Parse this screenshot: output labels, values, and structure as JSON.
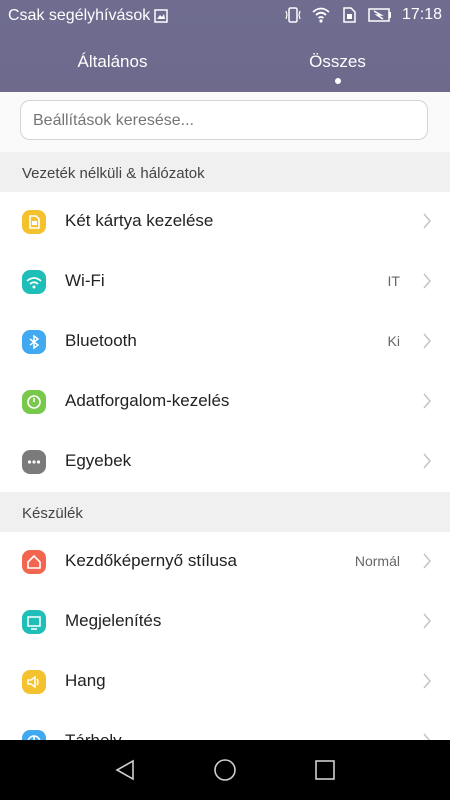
{
  "status_bar": {
    "carrier": "Csak segélyhívások",
    "time": "17:18"
  },
  "tabs": [
    {
      "label": "Általános",
      "active": false
    },
    {
      "label": "Összes",
      "active": true
    }
  ],
  "search": {
    "placeholder": "Beállítások keresése..."
  },
  "sections": [
    {
      "title": "Vezeték nélküli & hálózatok",
      "items": [
        {
          "label": "Két kártya kezelése",
          "value": "",
          "icon": "sim-card-icon",
          "color": "#f5c22f"
        },
        {
          "label": "Wi-Fi",
          "value": "IT",
          "icon": "wifi-icon",
          "color": "#1fbfb8"
        },
        {
          "label": "Bluetooth",
          "value": "Ki",
          "icon": "bluetooth-icon",
          "color": "#40a9f0"
        },
        {
          "label": "Adatforgalom-kezelés",
          "value": "",
          "icon": "data-usage-icon",
          "color": "#78c84b"
        },
        {
          "label": "Egyebek",
          "value": "",
          "icon": "more-icon",
          "color": "#7b7b7b"
        }
      ]
    },
    {
      "title": "Készülék",
      "items": [
        {
          "label": "Kezdőképernyő stílusa",
          "value": "Normál",
          "icon": "home-icon",
          "color": "#f2664f"
        },
        {
          "label": "Megjelenítés",
          "value": "",
          "icon": "display-icon",
          "color": "#1fbfb8"
        },
        {
          "label": "Hang",
          "value": "",
          "icon": "sound-icon",
          "color": "#f5c22f"
        },
        {
          "label": "Tárhely",
          "value": "",
          "icon": "storage-icon",
          "color": "#40a9f0"
        }
      ]
    }
  ]
}
